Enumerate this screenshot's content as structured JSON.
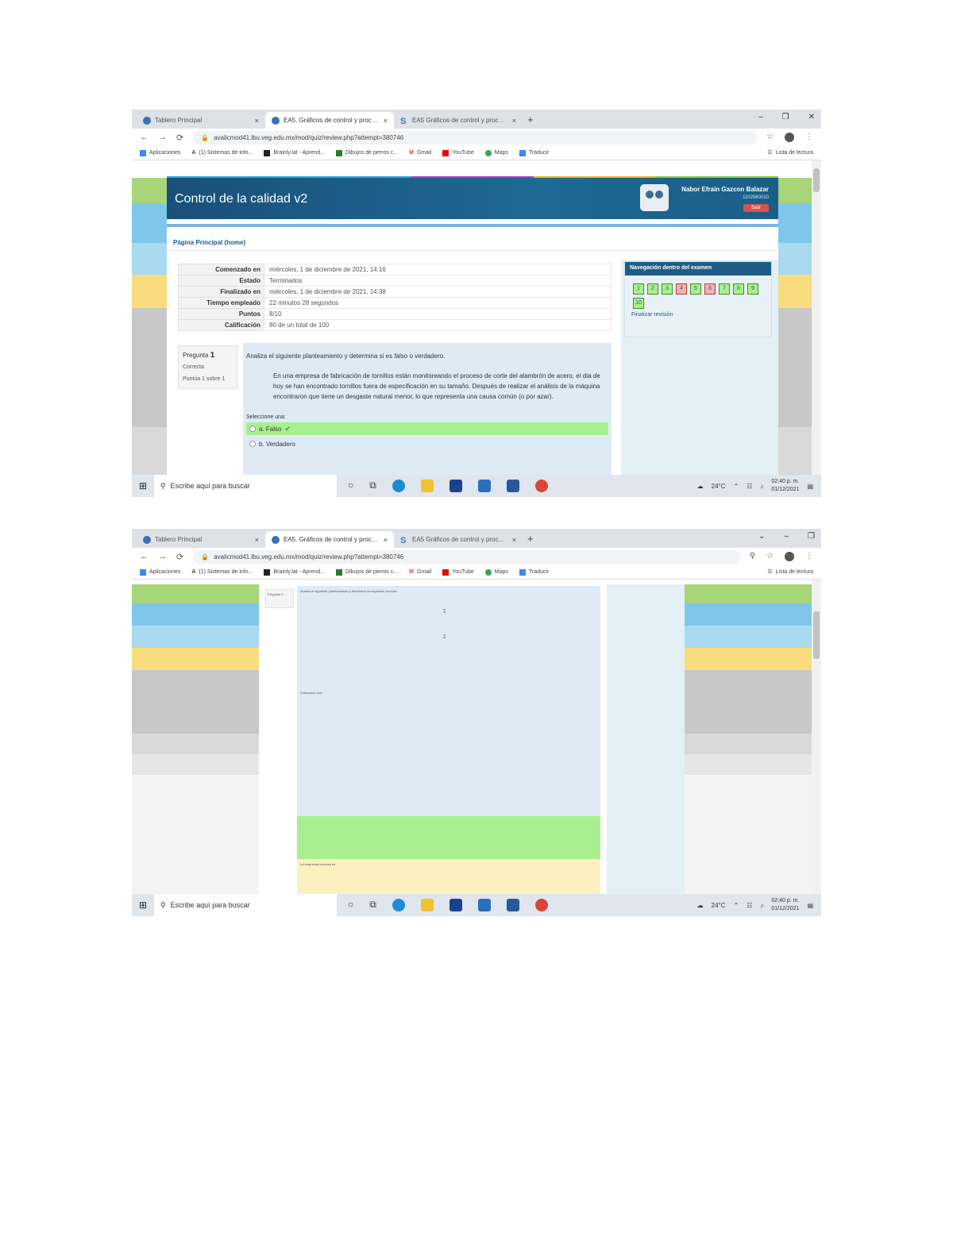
{
  "screenshot1": {
    "tabs": [
      {
        "title": "Tablero Principal",
        "icon": "moodle-icon"
      },
      {
        "title": "EA5. Gráficos de control y proceso",
        "icon": "moodle-icon"
      },
      {
        "title": "EA5 Gráficos de control y proceso",
        "icon": "studocu-icon"
      }
    ],
    "url": "avalicmod41.lbu.veg.edu.mx/mod/quiz/review.php?attempt=380746",
    "bookmarks": [
      "Aplicaciones",
      "(1) Sistemas de info...",
      "Brainly.lat - Aprend...",
      "Dibujos de perros c...",
      "Gmail",
      "YouTube",
      "Maps",
      "Traducir"
    ],
    "reading_list": "Lista de lectura",
    "site_title": "Control de la calidad v2",
    "user_name": "Nabor Efrain Gazcon Balazar",
    "user_id": "1102560010",
    "logout": "Salir",
    "breadcrumb": "Página Principal (home)",
    "summary": [
      {
        "label": "Comenzado en",
        "value": "miércoles, 1 de diciembre de 2021, 14:16"
      },
      {
        "label": "Estado",
        "value": "Terminados"
      },
      {
        "label": "Finalizado en",
        "value": "miércoles, 1 de diciembre de 2021, 14:38"
      },
      {
        "label": "Tiempo empleado",
        "value": "22 minutos 28 segundos"
      },
      {
        "label": "Puntos",
        "value": "8/10"
      },
      {
        "label": "Calificación",
        "value": "80 de un total de 100"
      }
    ],
    "question": {
      "label": "Pregunta",
      "number": "1",
      "status": "Correcta",
      "points": "Puntúa 1 sobre 1",
      "prompt": "Analiza el siguiente planteamiento y determina si es falso o verdadero.",
      "scenario": "En una empresa de fabricación de tornillos están monitoreando el proceso de corte del alambrón de acero, el día de hoy se han encontrado tornillos fuera de especificación en su tamaño. Después de realizar el análisis de la máquina encontraron que tiene un desgaste natural menor, lo que representa una causa común (o por azar).",
      "select_label": "Seleccione una:",
      "options": [
        {
          "text": "a. Falso",
          "correct": true
        },
        {
          "text": "b. Verdadero",
          "correct": false
        }
      ]
    },
    "quiz_nav": {
      "title": "Navegación dentro del examen",
      "buttons": [
        "1",
        "2",
        "3",
        "4",
        "5",
        "6",
        "7",
        "8",
        "9",
        "10"
      ],
      "wrong": [
        "4",
        "6"
      ],
      "finish": "Finalizar revisión"
    },
    "taskbar": {
      "search_placeholder": "Escribe aquí para buscar",
      "temperature": "24°C",
      "time": "02:40 p. m.",
      "date": "01/12/2021"
    }
  },
  "screenshot2": {
    "tabs": [
      {
        "title": "Tablero Principal",
        "icon": "moodle-icon"
      },
      {
        "title": "EA5. Gráficos de control y proceso",
        "icon": "moodle-icon"
      },
      {
        "title": "EA5 Gráficos de control y proceso",
        "icon": "studocu-icon"
      }
    ],
    "url": "avalicmod41.lbu.veg.edu.mx/mod/quiz/review.php?attempt=380746",
    "bookmarks": [
      "Aplicaciones",
      "(1) Sistemas de info...",
      "Brainly.lat - Aprend...",
      "Dibujos de perros c...",
      "Gmail",
      "YouTube",
      "Maps",
      "Traducir"
    ],
    "reading_list": "Lista de lectura",
    "question": {
      "label": "Pregunta",
      "number": "2",
      "prompt": "Analiza el siguiente planteamiento y determina la respuesta correcta.",
      "select_label": "Seleccione una:",
      "feedback_label": "La respuesta correcta es:"
    },
    "taskbar": {
      "search_placeholder": "Escribe aquí para buscar",
      "temperature": "24°C",
      "time": "02:40 p. m.",
      "date": "01/12/2021"
    }
  },
  "colors": {
    "header": "#1e6a92",
    "correct": "#a8f08f",
    "question_bg": "#deebf5",
    "feedback_bg": "#fbf0c0"
  }
}
